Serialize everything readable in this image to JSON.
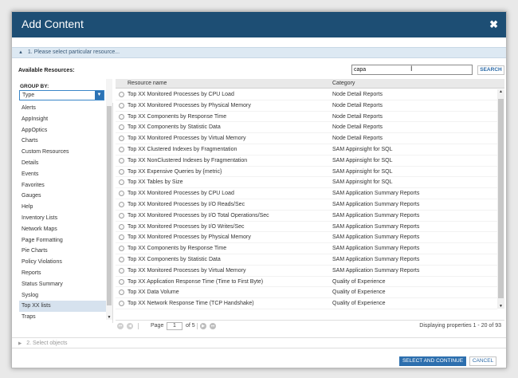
{
  "dialog": {
    "title": "Add Content",
    "close_glyph": "✖",
    "step1_label": "1. Please select particular resource...",
    "step2_label": "2. Select objects",
    "available_label": "Available Resources:",
    "search": {
      "value": "capa",
      "button_label": "SEARCH"
    },
    "group_by": {
      "label": "GROUP BY:",
      "selected": "Type",
      "items": [
        "Alerts",
        "AppInsight",
        "AppOptics",
        "Charts",
        "Custom Resources",
        "Details",
        "Events",
        "Favorites",
        "Gauges",
        "Help",
        "Inventory Lists",
        "Network Maps",
        "Page Formatting",
        "Pie Charts",
        "Policy Violations",
        "Reports",
        "Status Summary",
        "Syslog",
        "Top XX lists",
        "Traps"
      ],
      "selected_item": "Top XX lists"
    },
    "grid": {
      "col_name": "Resource name",
      "col_category": "Category",
      "rows": [
        {
          "name": "Top XX Monitored Processes by CPU Load",
          "category": "Node Detail Reports"
        },
        {
          "name": "Top XX Monitored Processes by Physical Memory",
          "category": "Node Detail Reports"
        },
        {
          "name": "Top XX Components by Response Time",
          "category": "Node Detail Reports"
        },
        {
          "name": "Top XX Components by Statistic Data",
          "category": "Node Detail Reports"
        },
        {
          "name": "Top XX Monitored Processes by Virtual Memory",
          "category": "Node Detail Reports"
        },
        {
          "name": "Top XX Clustered Indexes by Fragmentation",
          "category": "SAM Appinsight for SQL"
        },
        {
          "name": "Top XX NonClustered Indexes by Fragmentation",
          "category": "SAM Appinsight for SQL"
        },
        {
          "name": "Top XX Expensive Queries by {metric}",
          "category": "SAM Appinsight for SQL"
        },
        {
          "name": "Top XX Tables by Size",
          "category": "SAM Appinsight for SQL"
        },
        {
          "name": "Top XX Monitored Processes by CPU Load",
          "category": "SAM Application Summary Reports"
        },
        {
          "name": "Top XX Monitored Processes by I/O Reads/Sec",
          "category": "SAM Application Summary Reports"
        },
        {
          "name": "Top XX Monitored Processes by I/O Total Operations/Sec",
          "category": "SAM Application Summary Reports"
        },
        {
          "name": "Top XX Monitored Processes by I/O Writes/Sec",
          "category": "SAM Application Summary Reports"
        },
        {
          "name": "Top XX Monitored Processes by Physical Memory",
          "category": "SAM Application Summary Reports"
        },
        {
          "name": "Top XX Components by Response Time",
          "category": "SAM Application Summary Reports"
        },
        {
          "name": "Top XX Components by Statistic Data",
          "category": "SAM Application Summary Reports"
        },
        {
          "name": "Top XX Monitored Processes by Virtual Memory",
          "category": "SAM Application Summary Reports"
        },
        {
          "name": "Top XX Application Response Time (Time to First Byte)",
          "category": "Quality of Experience"
        },
        {
          "name": "Top XX Data Volume",
          "category": "Quality of Experience"
        },
        {
          "name": "Top XX Network Response Time (TCP Handshake)",
          "category": "Quality of Experience"
        }
      ]
    },
    "pager": {
      "page_label": "Page",
      "page_value": "1",
      "of_label": "of 5",
      "display_text": "Displaying properties 1 - 20 of 93"
    },
    "buttons": {
      "select_continue": "SELECT AND CONTINUE",
      "cancel": "CANCEL"
    }
  }
}
